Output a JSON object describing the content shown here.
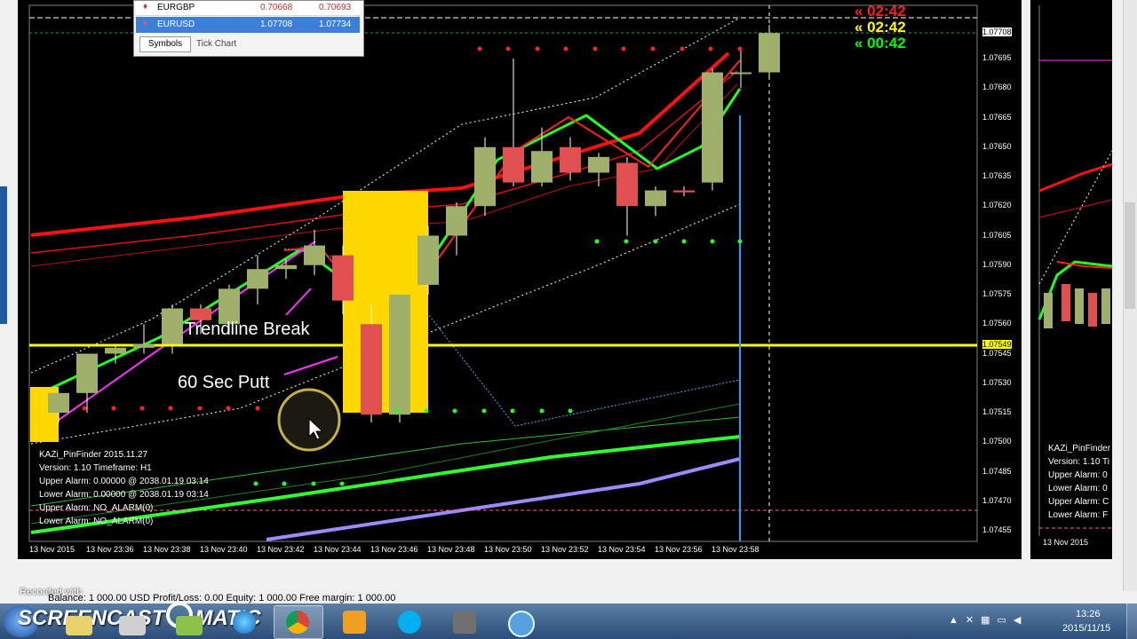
{
  "market_watch": {
    "rows": [
      {
        "symbol": "EURGBP",
        "bid": "0.70668",
        "ask": "0.70693"
      },
      {
        "symbol": "EURUSD",
        "bid": "1.07708",
        "ask": "1.07734"
      }
    ],
    "tabs": [
      "Symbols",
      "Tick Chart"
    ]
  },
  "timers": [
    {
      "text": "« 02:42",
      "color": "#ff1e1e"
    },
    {
      "text": "« 02:42",
      "color": "#ffff00"
    },
    {
      "text": "« 00:42",
      "color": "#00ff00"
    }
  ],
  "price_axis": [
    "1.07708",
    "1.07695",
    "1.07680",
    "1.07665",
    "1.07650",
    "1.07635",
    "1.07620",
    "1.07605",
    "1.07590",
    "1.07575",
    "1.07560",
    "1.07549",
    "1.07545",
    "1.07530",
    "1.07515",
    "1.07500",
    "1.07485",
    "1.07470",
    "1.07455"
  ],
  "time_axis": [
    "13 Nov 2015",
    "13 Nov 23:36",
    "13 Nov 23:38",
    "13 Nov 23:40",
    "13 Nov 23:42",
    "13 Nov 23:44",
    "13 Nov 23:46",
    "13 Nov 23:48",
    "13 Nov 23:50",
    "13 Nov 23:52",
    "13 Nov 23:54",
    "13 Nov 23:56",
    "13 Nov 23:58"
  ],
  "annotations": {
    "trendline_break": "Trendline Break",
    "sixty_sec_putt": "60 Sec Putt"
  },
  "indicator_panel": [
    "KAZi_PinFinder 2015.11.27",
    "Version: 1.10 Timeframe: H1",
    "Upper Alarm: 0.00000 @ 2038.01.19 03:14",
    "Lower Alarm: 0.00000 @ 2038.01.19 03:14",
    "Upper Alarm: NO_ALARM(0)",
    "Lower Alarm: NO_ALARM(0)"
  ],
  "right_chart": {
    "panel": [
      "KAZi_PinFinder",
      "Version: 1.10 Ti",
      "Upper Alarm: 0",
      "Lower Alarm: 0",
      "Upper Alarm: C",
      "Lower Alarm: F"
    ],
    "time_label": "13 Nov 2015"
  },
  "status_bar": {
    "watermark": "Recorded with",
    "account": "Balance: 1 000.00 USD  Profit/Loss: 0.00  Equity: 1 000.00  Free margin: 1 000.00"
  },
  "taskbar": {
    "brand": "SCREENCAST",
    "brand2": "MATIC",
    "time": "13:26",
    "date": "2015/11/15"
  },
  "candles": [
    {
      "t": "23:35a",
      "o": 1.07515,
      "h": 1.07525,
      "l": 1.0751,
      "c": 1.07525
    },
    {
      "t": "23:35b",
      "o": 1.07525,
      "h": 1.07545,
      "l": 1.07515,
      "c": 1.07545
    },
    {
      "t": "23:36a",
      "o": 1.07545,
      "h": 1.0755,
      "l": 1.0754,
      "c": 1.07548
    },
    {
      "t": "23:36b",
      "o": 1.07548,
      "h": 1.0756,
      "l": 1.07545,
      "c": 1.0755
    },
    {
      "t": "23:37a",
      "o": 1.0755,
      "h": 1.0757,
      "l": 1.07545,
      "c": 1.07568
    },
    {
      "t": "23:37b",
      "o": 1.07568,
      "h": 1.0757,
      "l": 1.07555,
      "c": 1.07562
    },
    {
      "t": "23:38a",
      "o": 1.0756,
      "h": 1.0758,
      "l": 1.07555,
      "c": 1.07578
    },
    {
      "t": "23:38b",
      "o": 1.07578,
      "h": 1.07595,
      "l": 1.0757,
      "c": 1.07588
    },
    {
      "t": "23:39a",
      "o": 1.07588,
      "h": 1.07593,
      "l": 1.07583,
      "c": 1.0759
    },
    {
      "t": "23:39b",
      "o": 1.0759,
      "h": 1.07608,
      "l": 1.07585,
      "c": 1.076
    },
    {
      "t": "23:40a",
      "o": 1.07595,
      "h": 1.076,
      "l": 1.07565,
      "c": 1.07572
    },
    {
      "t": "23:40b",
      "o": 1.0756,
      "h": 1.0757,
      "l": 1.0751,
      "c": 1.07514
    },
    {
      "t": "23:41a",
      "o": 1.07514,
      "h": 1.07575,
      "l": 1.0751,
      "c": 1.07575
    },
    {
      "t": "23:41b",
      "o": 1.0758,
      "h": 1.0761,
      "l": 1.07575,
      "c": 1.07605
    },
    {
      "t": "23:42a",
      "o": 1.07605,
      "h": 1.07622,
      "l": 1.07595,
      "c": 1.0762
    },
    {
      "t": "23:42b",
      "o": 1.0762,
      "h": 1.07655,
      "l": 1.07615,
      "c": 1.0765
    },
    {
      "t": "23:43a",
      "o": 1.0765,
      "h": 1.07695,
      "l": 1.0763,
      "c": 1.07632
    },
    {
      "t": "23:43b",
      "o": 1.07632,
      "h": 1.0766,
      "l": 1.0763,
      "c": 1.07648
    },
    {
      "t": "23:44a",
      "o": 1.0765,
      "h": 1.07655,
      "l": 1.07633,
      "c": 1.07637
    },
    {
      "t": "23:44b",
      "o": 1.07637,
      "h": 1.07647,
      "l": 1.0763,
      "c": 1.07645
    },
    {
      "t": "23:45a",
      "o": 1.07642,
      "h": 1.07645,
      "l": 1.07605,
      "c": 1.0762
    },
    {
      "t": "23:45b",
      "o": 1.0762,
      "h": 1.0763,
      "l": 1.07615,
      "c": 1.07628
    },
    {
      "t": "23:46a",
      "o": 1.07628,
      "h": 1.0763,
      "l": 1.07625,
      "c": 1.07627
    },
    {
      "t": "23:46b",
      "o": 1.07632,
      "h": 1.0769,
      "l": 1.07628,
      "c": 1.07688
    },
    {
      "t": "23:47a",
      "o": 1.07688,
      "h": 1.077,
      "l": 1.0768,
      "c": 1.07688
    },
    {
      "t": "23:47b",
      "o": 1.07688,
      "h": 1.07712,
      "l": 1.07685,
      "c": 1.07708
    }
  ]
}
